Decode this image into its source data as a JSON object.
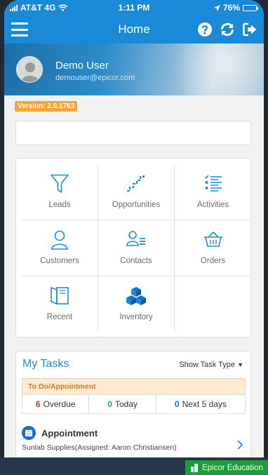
{
  "status_bar": {
    "carrier": "AT&T 4G",
    "time": "1:11 PM",
    "battery": "76%",
    "battery_level": 0.76
  },
  "header": {
    "title": "Home"
  },
  "profile": {
    "name": "Demo User",
    "email": "demouser@epicor.com"
  },
  "version": "Version: 2.0.1763",
  "modules": [
    {
      "label": "Leads",
      "icon": "funnel-icon"
    },
    {
      "label": "Opportunities",
      "icon": "stairs-icon"
    },
    {
      "label": "Activities",
      "icon": "checklist-icon"
    },
    {
      "label": "Customers",
      "icon": "person-icon"
    },
    {
      "label": "Contacts",
      "icon": "contact-list-icon"
    },
    {
      "label": "Orders",
      "icon": "basket-icon"
    },
    {
      "label": "Recent",
      "icon": "book-icon"
    },
    {
      "label": "Inventory",
      "icon": "boxes-icon"
    }
  ],
  "tasks": {
    "title": "My Tasks",
    "filter": "Show Task Type",
    "section": "To Do/Appointment",
    "overdue_count": "6",
    "overdue_label": "Overdue",
    "today_count": "0",
    "today_label": "Today",
    "next_count": "0",
    "next_label": "Next 5 days",
    "item_type": "Appointment",
    "item_detail": "Sunlab Supplies(Assigned: Aaron Christiansen)"
  },
  "branding": "Epicor Education",
  "colors": {
    "header": "#1a8ad8",
    "version_badge": "#f4a533",
    "overdue": "#d9302b",
    "today": "#2ea84a",
    "next": "#1a6fc9",
    "brand": "#1e9b3b"
  }
}
